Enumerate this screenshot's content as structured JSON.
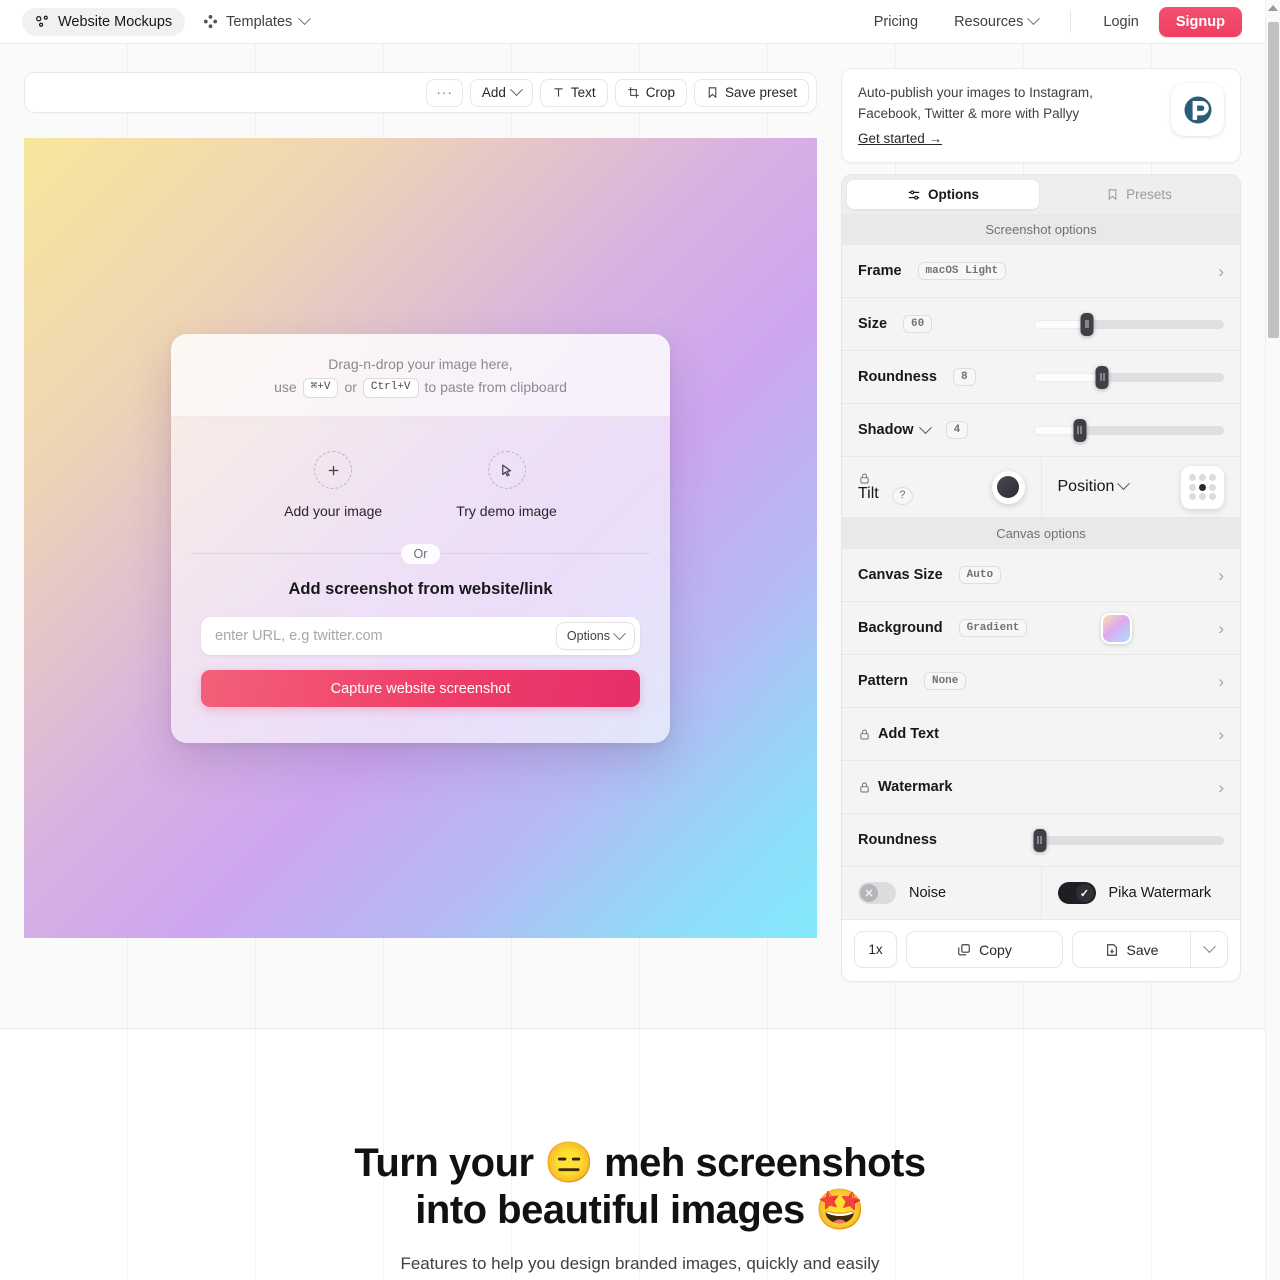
{
  "nav": {
    "brand": "Website Mockups",
    "templates": "Templates",
    "pricing": "Pricing",
    "resources": "Resources",
    "login": "Login",
    "signup": "Signup"
  },
  "toolbar": {
    "more": "···",
    "add": "Add",
    "text": "Text",
    "crop": "Crop",
    "save_preset": "Save preset"
  },
  "canvas": {
    "gradient_from": "#f7e79c",
    "gradient_mid": "#cda6ef",
    "gradient_to": "#84e9fb"
  },
  "drop_card": {
    "line1": "Drag-n-drop your image here,",
    "use": "use",
    "key_mac": "⌘+V",
    "or_word": "or",
    "key_win": "Ctrl+V",
    "paste_tail": "to paste from clipboard",
    "add_image": "Add your image",
    "demo_image": "Try demo image",
    "or": "Or",
    "url_heading": "Add screenshot from website/link",
    "url_value": "",
    "url_placeholder": "enter URL, e.g twitter.com",
    "options": "Options",
    "capture": "Capture website screenshot"
  },
  "promo": {
    "text": "Auto-publish your images to Instagram, Facebook, Twitter & more with Pallyy",
    "cta": "Get started →"
  },
  "panel": {
    "tabs": [
      {
        "label": "Options",
        "icon": "sliders-icon",
        "active": true
      },
      {
        "label": "Presets",
        "icon": "bookmark-icon",
        "active": false
      }
    ],
    "screenshot_section": "Screenshot options",
    "canvas_section": "Canvas options",
    "frame": {
      "label": "Frame",
      "value": "macOS Light"
    },
    "size": {
      "label": "Size",
      "value": "60",
      "percent": 28
    },
    "roundness": {
      "label": "Roundness",
      "value": "8",
      "percent": 36
    },
    "shadow": {
      "label": "Shadow",
      "value": "4",
      "percent": 24
    },
    "tilt": {
      "label": "Tilt",
      "help": "?"
    },
    "position": {
      "label": "Position",
      "selected_index": 4
    },
    "canvas_size": {
      "label": "Canvas Size",
      "value": "Auto"
    },
    "background": {
      "label": "Background",
      "value": "Gradient"
    },
    "pattern": {
      "label": "Pattern",
      "value": "None"
    },
    "add_text": {
      "label": "Add Text"
    },
    "watermark": {
      "label": "Watermark"
    },
    "canvas_roundness": {
      "label": "Roundness",
      "percent": 3
    },
    "noise": {
      "label": "Noise",
      "on": false
    },
    "pika_watermark": {
      "label": "Pika Watermark",
      "on": true
    },
    "zoom": "1x",
    "copy": "Copy",
    "save": "Save"
  },
  "hero": {
    "title_line1": "Turn your 😑 meh screenshots",
    "title_line2": "into beautiful images 🤩",
    "subtitle": "Features to help you design branded images, quickly and easily"
  }
}
